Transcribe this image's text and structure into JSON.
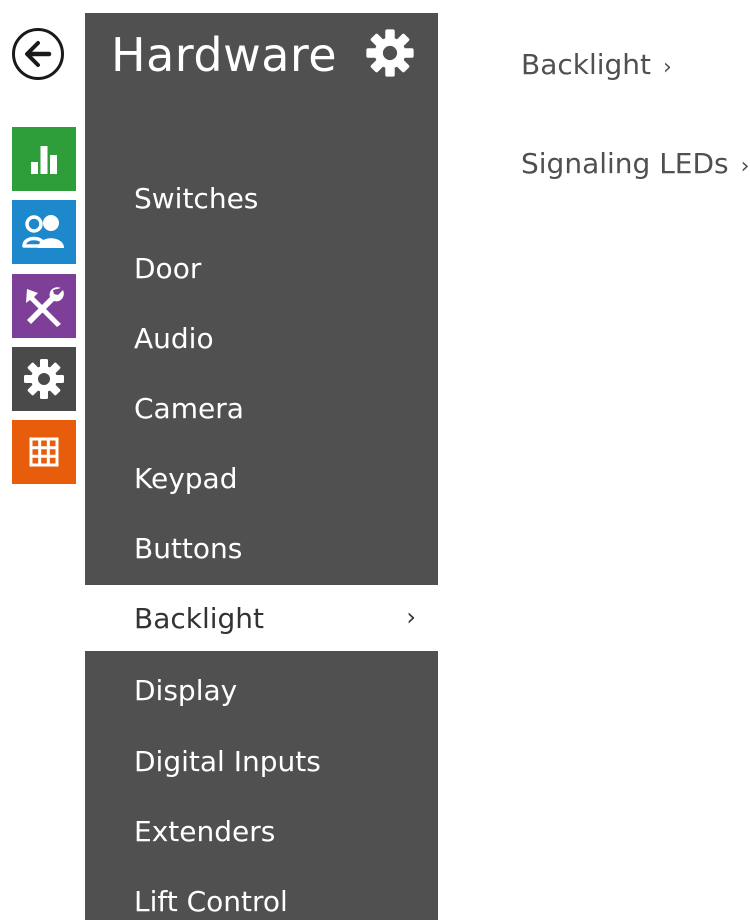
{
  "rail": {
    "back": {
      "icon": "arrow-left-icon"
    },
    "buttons": [
      {
        "id": "status",
        "icon": "bar-chart-icon",
        "color": "#2e9e3b"
      },
      {
        "id": "directory",
        "icon": "users-icon",
        "color": "#1e88cd"
      },
      {
        "id": "services",
        "icon": "tools-icon",
        "color": "#7d3f98"
      },
      {
        "id": "hardware",
        "icon": "gear-icon",
        "color": "#4a4a4a"
      },
      {
        "id": "system",
        "icon": "grid-icon",
        "color": "#e85d0c"
      }
    ]
  },
  "menu": {
    "title": "Hardware",
    "settings_icon": "gear-icon",
    "background": "#505050",
    "items": [
      {
        "label": "Switches",
        "active": false
      },
      {
        "label": "Door",
        "active": false
      },
      {
        "label": "Audio",
        "active": false
      },
      {
        "label": "Camera",
        "active": false
      },
      {
        "label": "Keypad",
        "active": false
      },
      {
        "label": "Buttons",
        "active": false
      },
      {
        "label": "Backlight",
        "active": true,
        "chevron": "›"
      },
      {
        "label": "Display",
        "active": false
      },
      {
        "label": "Digital Inputs",
        "active": false
      },
      {
        "label": "Extenders",
        "active": false
      },
      {
        "label": "Lift Control",
        "active": false
      }
    ]
  },
  "content": {
    "links": [
      {
        "label": "Backlight",
        "chevron": "›"
      },
      {
        "label": "Signaling LEDs",
        "chevron": "›"
      }
    ]
  }
}
